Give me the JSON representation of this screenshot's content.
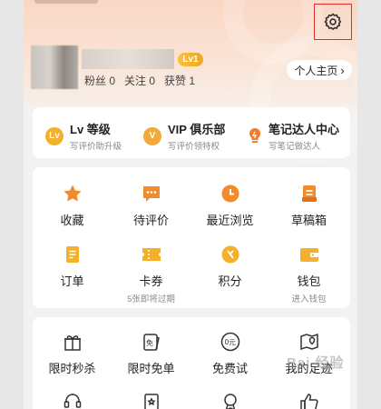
{
  "profile": {
    "level_badge": "Lv1",
    "fans": "粉丝 0",
    "following": "关注 0",
    "likes": "获赞 1",
    "home_button": "个人主页"
  },
  "features": [
    {
      "title": "Lv 等级",
      "subtitle": "写评价助升级",
      "icon": "lv-icon",
      "icon_text": "Lv",
      "color": "#f5b02a"
    },
    {
      "title": "VIP 俱乐部",
      "subtitle": "写评价领特权",
      "icon": "vip-icon",
      "icon_text": "V",
      "color": "#f3a83a"
    },
    {
      "title": "笔记达人中心",
      "subtitle": "写笔记做达人",
      "icon": "bulb-icon",
      "icon_text": "",
      "color": "#f57a2a"
    }
  ],
  "grid_main": [
    {
      "label": "收藏",
      "sub": "",
      "icon": "star-icon"
    },
    {
      "label": "待评价",
      "sub": "",
      "icon": "comment-icon"
    },
    {
      "label": "最近浏览",
      "sub": "",
      "icon": "clock-icon"
    },
    {
      "label": "草稿箱",
      "sub": "",
      "icon": "draft-icon"
    },
    {
      "label": "订单",
      "sub": "",
      "icon": "order-icon"
    },
    {
      "label": "卡券",
      "sub": "5张即将过期",
      "icon": "coupon-icon"
    },
    {
      "label": "积分",
      "sub": "",
      "icon": "points-icon"
    },
    {
      "label": "钱包",
      "sub": "进入钱包",
      "icon": "wallet-icon"
    }
  ],
  "grid_services": [
    {
      "label": "限时秒杀",
      "icon": "gift-icon"
    },
    {
      "label": "限时免单",
      "icon": "free-ticket-icon",
      "icon_text": "免"
    },
    {
      "label": "免费试",
      "icon": "free-trial-icon",
      "icon_text": "0元"
    },
    {
      "label": "我的足迹",
      "icon": "map-pin-icon"
    }
  ],
  "watermark": "Bai 经验",
  "colors": {
    "accent": "#f28a2e",
    "highlight": "#e0302a"
  }
}
